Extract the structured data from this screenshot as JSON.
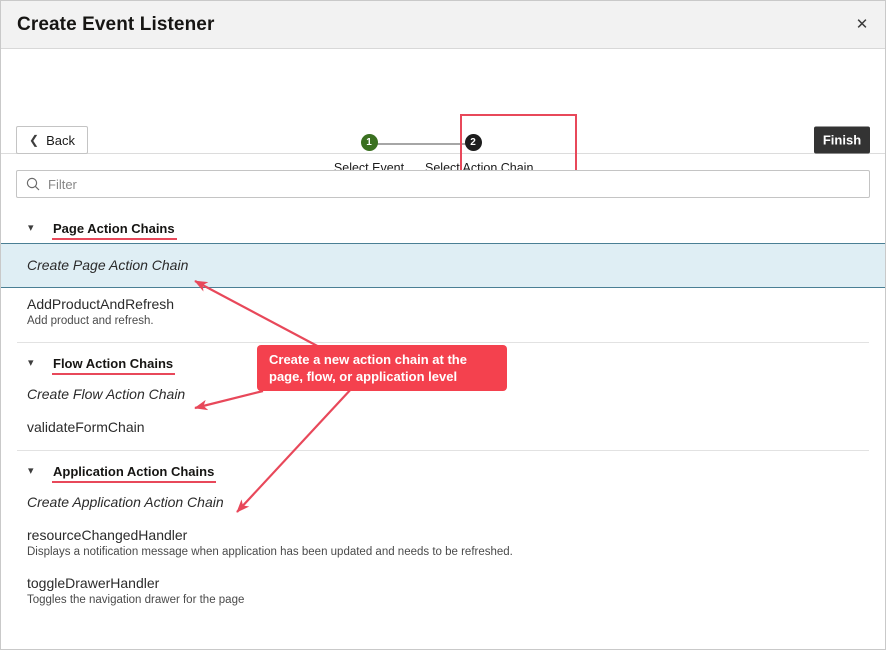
{
  "dialog": {
    "title": "Create Event Listener",
    "close_icon": "close-icon"
  },
  "wizard": {
    "back_label": "Back",
    "back_icon": "chevron-left-icon",
    "finish_label": "Finish",
    "steps": [
      {
        "number": "1",
        "label": "Select Event",
        "state": "done",
        "color": "#3a7020"
      },
      {
        "number": "2",
        "label": "Select Action Chain",
        "state": "active",
        "color": "#1d1d1d"
      }
    ]
  },
  "filter": {
    "placeholder": "Filter",
    "value": "",
    "icon": "search-icon"
  },
  "groups": [
    {
      "title": "Page Action Chains",
      "chevron": "chevron-down-icon",
      "items": [
        {
          "title": "Create Page Action Chain",
          "desc": "",
          "create": true,
          "selected": true
        },
        {
          "title": "AddProductAndRefresh",
          "desc": "Add product and refresh.",
          "create": false,
          "selected": false
        }
      ]
    },
    {
      "title": "Flow Action Chains",
      "chevron": "chevron-down-icon",
      "items": [
        {
          "title": "Create Flow Action Chain",
          "desc": "",
          "create": true,
          "selected": false
        },
        {
          "title": "validateFormChain",
          "desc": "",
          "create": false,
          "selected": false
        }
      ]
    },
    {
      "title": "Application Action Chains",
      "chevron": "chevron-down-icon",
      "items": [
        {
          "title": "Create Application Action Chain",
          "desc": "",
          "create": true,
          "selected": false
        },
        {
          "title": "resourceChangedHandler",
          "desc": "Displays a notification message when application has been updated and needs to be refreshed.",
          "create": false,
          "selected": false
        },
        {
          "title": "toggleDrawerHandler",
          "desc": "Toggles the navigation drawer for the page",
          "create": false,
          "selected": false
        }
      ]
    }
  ],
  "annotation": {
    "callout_text": "Create a new action chain at the page, flow, or application level",
    "accent_color": "#f4414e",
    "highlight_border_color": "#e8485a"
  }
}
